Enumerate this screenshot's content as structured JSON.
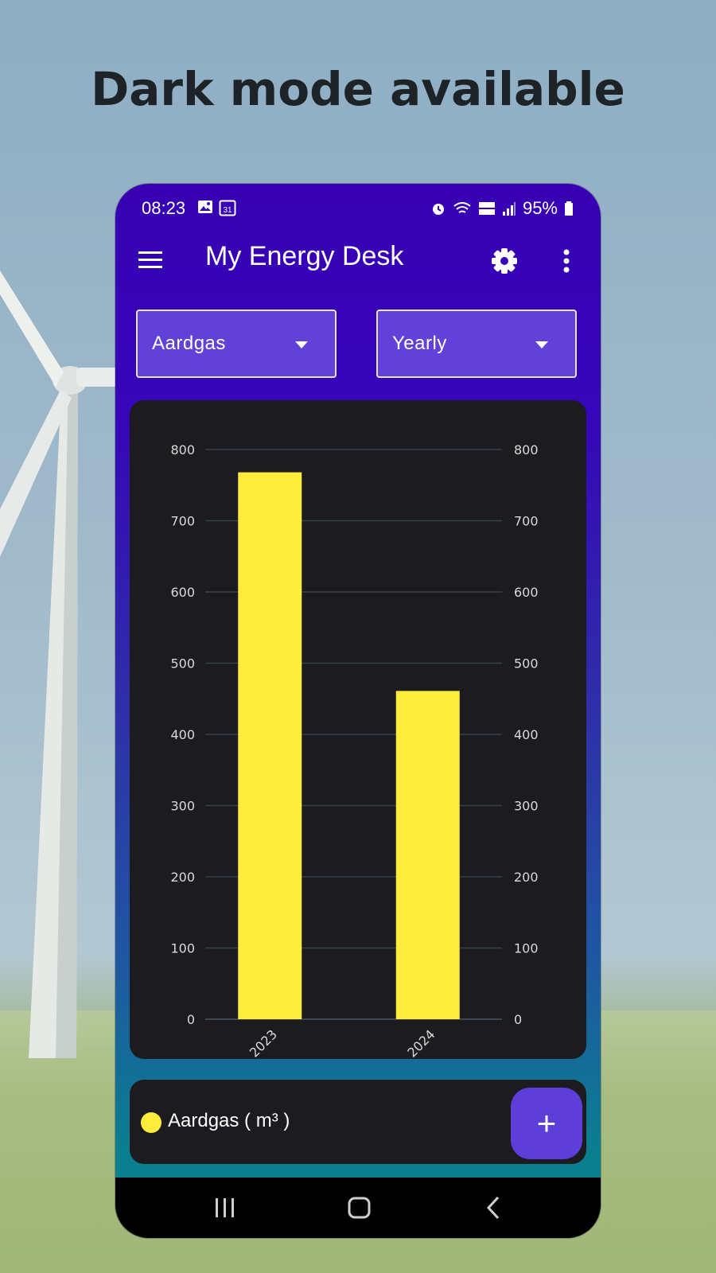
{
  "promo": {
    "headline": "Dark mode available"
  },
  "status_bar": {
    "time": "08:23",
    "battery": "95%"
  },
  "app_bar": {
    "title": "My Energy Desk"
  },
  "filters": {
    "energy_type": "Aardgas",
    "period": "Yearly"
  },
  "legend": {
    "label": "Aardgas ( m³ )",
    "color": "#ffeb3b"
  },
  "fab": {
    "label": "+"
  },
  "colors": {
    "primary": "#3700b3",
    "dropdown": "#6241d9",
    "card": "#1c1c20",
    "bar": "#ffeb3b",
    "fab": "#5d3ed8"
  },
  "icons": {
    "menu": "menu-icon",
    "settings": "gear-icon",
    "more": "more-vert-icon",
    "recent": "recent-apps-icon",
    "home": "home-icon",
    "back": "back-icon"
  },
  "chart_data": {
    "type": "bar",
    "categories": [
      "2023",
      "2024"
    ],
    "series": [
      {
        "name": "Aardgas ( m³ )",
        "values": [
          768,
          461
        ]
      }
    ],
    "title": "",
    "xlabel": "",
    "ylabel": "",
    "ylim": [
      0,
      800
    ],
    "yticks": [
      0,
      100,
      200,
      300,
      400,
      500,
      600,
      700,
      800
    ],
    "secondary_y_axis": true,
    "grid": true
  }
}
